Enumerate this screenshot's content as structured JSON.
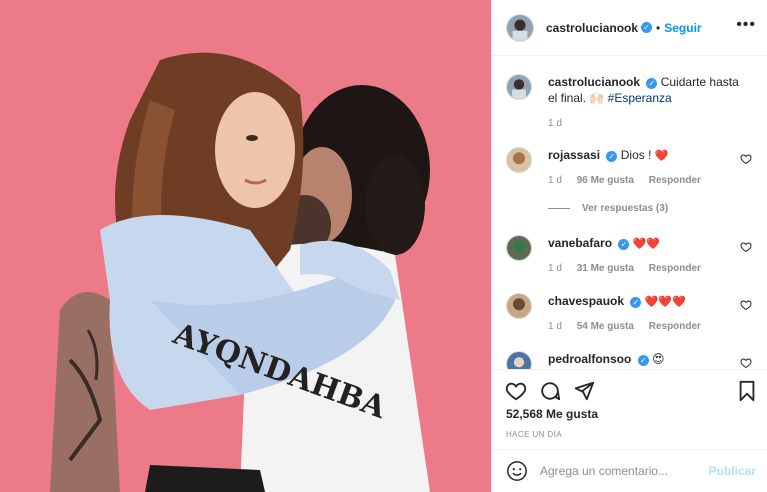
{
  "post": {
    "author": "castrolucianook",
    "follow_label": "Seguir",
    "more_label": "•••"
  },
  "caption": {
    "username": "castrolucianook",
    "text": "Cuidarte hasta el final. 🙌🏻 ",
    "hashtag": "#Esperanza",
    "time": "1 d"
  },
  "comments": [
    {
      "username": "rojassasi",
      "text": "Dios ! ",
      "hearts": "❤️",
      "time": "1 d",
      "likes": "96 Me gusta",
      "reply": "Responder"
    },
    {
      "username": "vanebafaro",
      "text": "",
      "hearts": "❤️❤️",
      "time": "1 d",
      "likes": "31 Me gusta",
      "reply": "Responder"
    },
    {
      "username": "chavespauok",
      "text": "",
      "hearts": "❤️❤️❤️",
      "time": "1 d",
      "likes": "54 Me gusta",
      "reply": "Responder"
    },
    {
      "username": "pedroalfonsoo",
      "text": "😍",
      "hearts": "",
      "time": "",
      "likes": "",
      "reply": ""
    }
  ],
  "view_replies": "Ver respuestas (3)",
  "likes_count": "52,568 Me gusta",
  "time_ago": "HACE UN DÍA",
  "add_comment": {
    "placeholder": "Agrega un comentario...",
    "publish_label": "Publicar"
  },
  "colors": {
    "photo_background": "#ed7a89",
    "link_blue": "#0095f6",
    "verified_blue": "#3897f0",
    "heart_red": "#e0245e"
  },
  "icons": [
    "verified-badge-icon",
    "heart-icon",
    "comment-icon",
    "share-icon",
    "bookmark-icon",
    "emoji-icon",
    "more-options-icon"
  ]
}
